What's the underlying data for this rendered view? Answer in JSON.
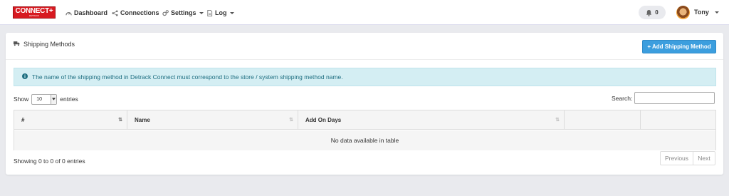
{
  "brand": {
    "name": "CONNECT+",
    "tagline": "DETRACK",
    "color": "#d71920"
  },
  "nav": {
    "items": [
      {
        "label": "Dashboard",
        "icon": "dashboard-icon",
        "dropdown": false
      },
      {
        "label": "Connections",
        "icon": "share-icon",
        "dropdown": false
      },
      {
        "label": "Settings",
        "icon": "gears-icon",
        "dropdown": true
      },
      {
        "label": "Log",
        "icon": "file-icon",
        "dropdown": true
      }
    ],
    "notifications": {
      "icon": "bell-icon",
      "count": "0"
    },
    "user": {
      "name": "Tony",
      "dropdown": true
    }
  },
  "panel": {
    "title": "Shipping Methods",
    "title_icon": "truck-icon",
    "add_button": "+ Add Shipping Method",
    "alert": "The name of the shipping method in Detrack Connect must correspond to the store / system shipping method name.",
    "alert_icon": "info-circle-icon",
    "accent": "#3c9ede"
  },
  "table_controls": {
    "show_label": "Show",
    "page_length": "10",
    "entries_label": "entries",
    "search_label": "Search:",
    "search_value": ""
  },
  "table": {
    "columns": [
      "#",
      "Name",
      "Add On Days",
      "",
      ""
    ],
    "empty_message": "No data available in table"
  },
  "footer": {
    "info": "Showing 0 to 0 of 0 entries",
    "prev": "Previous",
    "next": "Next"
  }
}
